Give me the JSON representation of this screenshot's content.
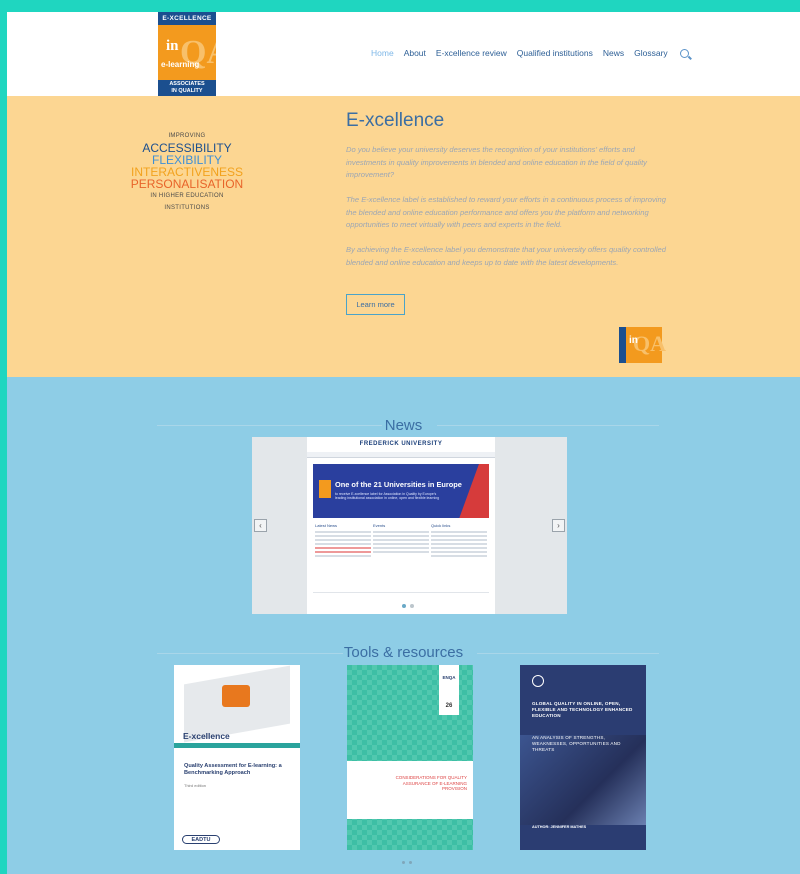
{
  "logo": {
    "top": "E-XCELLENCE",
    "in": "in",
    "qa": "QA",
    "elearning": "e-learning",
    "bottom1": "ASSOCIATES",
    "bottom2": "IN QUALITY"
  },
  "nav": {
    "items": [
      "Home",
      "About",
      "E-xcellence review",
      "Qualified institutions",
      "News",
      "Glossary"
    ],
    "active": "Home"
  },
  "hero": {
    "tagline": {
      "top": "IMPROVING",
      "l1": "ACCESSIBILITY",
      "l2": "FLEXIBILITY",
      "l3": "INTERACTIVENESS",
      "l4": "PERSONALISATION",
      "bottom": "IN HIGHER EDUCATION INSTITUTIONS"
    },
    "title": "E-xcellence",
    "p1": "Do you believe your university deserves the recognition of your institutions' efforts and investments in quality improvements in blended and online education in the field of quality improvement?",
    "p2": "The E-xcellence label is established to reward your efforts in a continuous process of improving the blended and online education performance and offers you the platform and networking opportunities to meet virtually with peers and experts in the field.",
    "p3": "By achieving the E-xcellence label you demonstrate that your university offers quality controlled blended and online education and keeps up to date with the latest developments.",
    "button": "Learn more"
  },
  "news": {
    "title": "News",
    "slide": {
      "university": "FREDERICK UNIVERSITY",
      "banner": "One of the 21 Universities in Europe",
      "banner_sub": "to receive E-xcellence label for Association in Quality by Europe's leading institutional association in online, open and flexible learning",
      "col_titles": [
        "Latest News",
        "Events",
        "Quick links"
      ]
    }
  },
  "tools": {
    "title": "Tools & resources",
    "cards": [
      {
        "brand": "E-xcellence",
        "title": "Quality Assessment for E-learning: a Benchmarking Approach",
        "edition": "Third edition",
        "publisher": "EADTU"
      },
      {
        "brand": "ENQA",
        "number": "26",
        "title": "CONSIDERATIONS FOR QUALITY ASSURANCE OF E-LEARNING PROVISION"
      },
      {
        "title": "GLOBAL QUALITY IN ONLINE, OPEN, FLEXIBLE AND TECHNOLOGY ENHANCED EDUCATION",
        "subtitle": "AN ANALYSIS OF STRENGTHS, WEAKNESSES, OPPORTUNITIES AND THREATS",
        "author": "AUTHOR: JENNIFER MATHES"
      }
    ]
  },
  "colors": {
    "hero_bg": "#fcd692",
    "lower_bg": "#8ecde6",
    "frame": "#1fd6c0",
    "accent": "#3b6ea3"
  }
}
